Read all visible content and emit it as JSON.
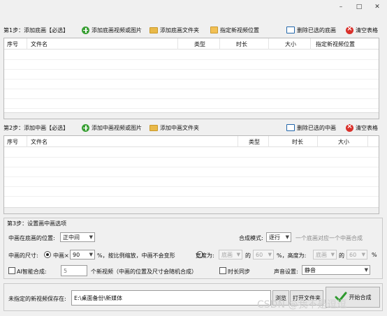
{
  "window": {
    "minimize": "–",
    "maximize": "□",
    "close": "✕"
  },
  "step1": {
    "label": "第1步：添加底画【必选】",
    "add_files": "添加底画视频或图片",
    "add_folder": "添加底画文件夹",
    "set_location": "指定新视频位置",
    "delete_selected": "删除已选的底画",
    "clear_table": "清空表格",
    "columns": [
      "序号",
      "文件名",
      "类型",
      "时长",
      "大小",
      "指定新视频位置"
    ]
  },
  "step2": {
    "label": "第2步：添加中画【必选】",
    "add_files": "添加中画视频或图片",
    "add_folder": "添加中画文件夹",
    "delete_selected": "删除已选的中画",
    "clear_table": "清空表格",
    "columns": [
      "序号",
      "文件名",
      "类型",
      "时长",
      "大小"
    ]
  },
  "step3": {
    "label": "第3步：设置画中画选项",
    "position_label": "中画在底画的位置:",
    "position_value": "正中间",
    "mode_label": "合成模式:",
    "mode_value": "逐行",
    "mode_hint": "一个底画对应一个中画合成",
    "size_label": "中画的尺寸:",
    "scale_label": "中画×",
    "scale_value": "90",
    "scale_hint": "%，按比例缩放，中画不会变形",
    "width_label": "宽度为:",
    "width_ref": "底画",
    "of_label": "的",
    "width_pct": "60",
    "height_label": "%，高度为:",
    "height_ref": "底画",
    "height_pct": "60",
    "pct": "%",
    "ai_label": "AI智能合成:",
    "ai_count": "5",
    "ai_hint": "个新视频（中画的位置及尺寸会随机合成）",
    "sync_label": "时长同步",
    "sound_label": "声音设置:",
    "sound_value": "静音"
  },
  "output": {
    "label": "未指定的新视频保存在:",
    "path": "E:\\桌面备份\\新媒体",
    "browse": "浏览",
    "open_folder": "打开文件夹",
    "start": "开始合成"
  },
  "watermark": "CSDN @我不是逗逗"
}
